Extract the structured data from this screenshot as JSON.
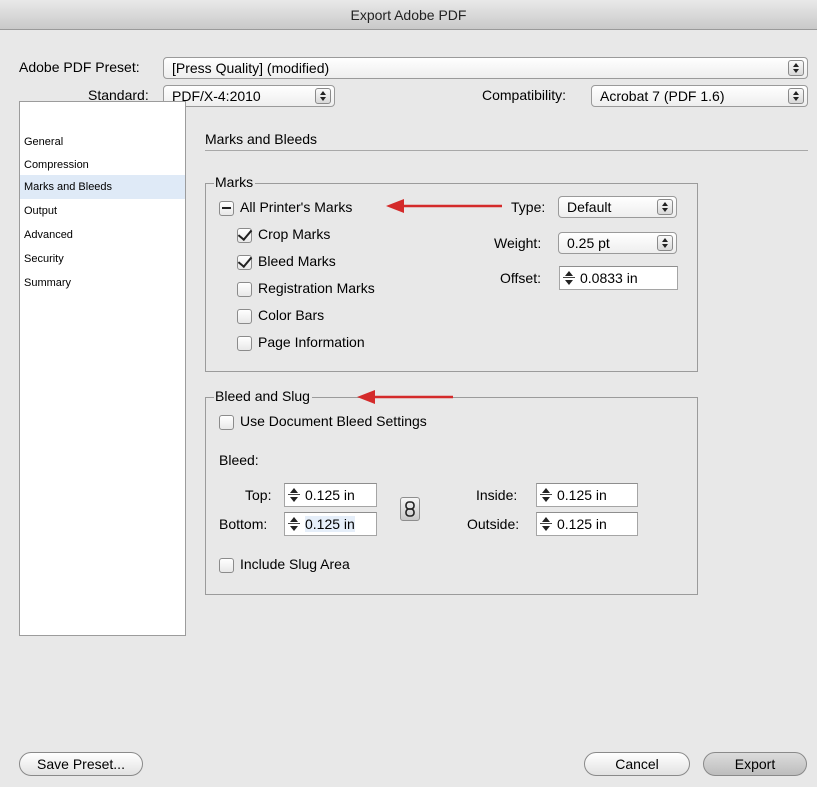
{
  "window": {
    "title": "Export Adobe PDF"
  },
  "preset": {
    "label": "Adobe PDF Preset:",
    "value": "[Press Quality] (modified)"
  },
  "standard": {
    "label": "Standard:",
    "value": "PDF/X-4:2010"
  },
  "compatibility": {
    "label": "Compatibility:",
    "value": "Acrobat 7 (PDF 1.6)"
  },
  "sidebar": {
    "items": [
      {
        "label": "General"
      },
      {
        "label": "Compression"
      },
      {
        "label": "Marks and Bleeds"
      },
      {
        "label": "Output"
      },
      {
        "label": "Advanced"
      },
      {
        "label": "Security"
      },
      {
        "label": "Summary"
      }
    ],
    "selected": "Marks and Bleeds"
  },
  "main": {
    "title": "Marks and Bleeds"
  },
  "marks": {
    "title": "Marks",
    "all_printers_marks": {
      "label": "All Printer's Marks",
      "state": "mixed"
    },
    "crop_marks": {
      "label": "Crop Marks",
      "checked": true
    },
    "bleed_marks": {
      "label": "Bleed Marks",
      "checked": true
    },
    "registration_marks": {
      "label": "Registration Marks",
      "checked": false
    },
    "color_bars": {
      "label": "Color Bars",
      "checked": false
    },
    "page_information": {
      "label": "Page Information",
      "checked": false
    },
    "type": {
      "label": "Type:",
      "value": "Default"
    },
    "weight": {
      "label": "Weight:",
      "value": "0.25 pt"
    },
    "offset": {
      "label": "Offset:",
      "value": "0.0833 in"
    }
  },
  "bleed_slug": {
    "title": "Bleed and Slug",
    "use_document_bleed": {
      "label": "Use Document Bleed Settings",
      "checked": false
    },
    "bleed_label": "Bleed:",
    "top": {
      "label": "Top:",
      "value": "0.125 in"
    },
    "bottom": {
      "label": "Bottom:",
      "value": "0.125 in"
    },
    "inside": {
      "label": "Inside:",
      "value": "0.125 in"
    },
    "outside": {
      "label": "Outside:",
      "value": "0.125 in"
    },
    "include_slug": {
      "label": "Include Slug Area",
      "checked": false
    }
  },
  "buttons": {
    "save_preset": "Save Preset...",
    "cancel": "Cancel",
    "export": "Export"
  },
  "colors": {
    "accent_arrow": "#d42a2a",
    "selection": "#dfeaf7"
  }
}
